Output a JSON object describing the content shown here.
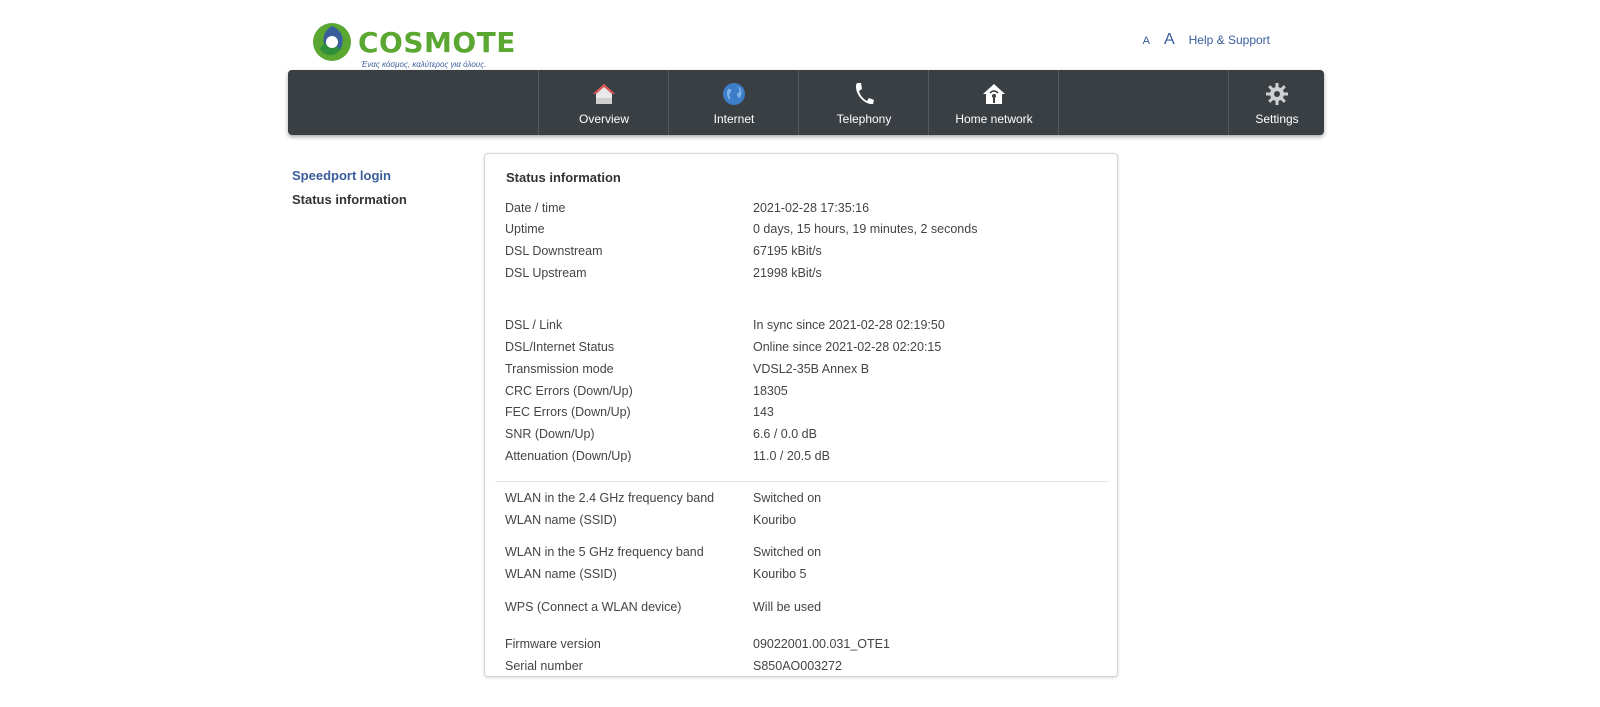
{
  "brand": {
    "name": "COSMOTE",
    "slogan": "Ένας κόσμος, καλύτερος για όλους."
  },
  "topbar": {
    "font_small": "A",
    "font_large": "A",
    "help": "Help & Support"
  },
  "nav": {
    "items": [
      {
        "label": "Overview",
        "icon": "house-icon"
      },
      {
        "label": "Internet",
        "icon": "globe-icon"
      },
      {
        "label": "Telephony",
        "icon": "phone-icon"
      },
      {
        "label": "Home network",
        "icon": "home-network-icon"
      },
      {
        "label": "Settings",
        "icon": "gear-icon"
      }
    ]
  },
  "sidebar": {
    "login": "Speedport login",
    "status": "Status information"
  },
  "panel": {
    "title": "Status information",
    "rows": [
      {
        "key": "Date / time",
        "value": "2021-02-28 17:35:16"
      },
      {
        "key": "Uptime",
        "value": "0 days, 15 hours, 19 minutes, 2 seconds"
      },
      {
        "key": "DSL Downstream",
        "value": "67195 kBit/s"
      },
      {
        "key": "DSL Upstream",
        "value": "21998 kBit/s"
      },
      {
        "key": "DSL / Link",
        "value": "In sync since 2021-02-28 02:19:50"
      },
      {
        "key": "DSL/Internet Status",
        "value": "Online since 2021-02-28 02:20:15"
      },
      {
        "key": "Transmission mode",
        "value": "VDSL2-35B Annex B"
      },
      {
        "key": "CRC Errors (Down/Up)",
        "value": "18305"
      },
      {
        "key": "FEC Errors (Down/Up)",
        "value": "143"
      },
      {
        "key": "SNR (Down/Up)",
        "value": "6.6 / 0.0 dB"
      },
      {
        "key": "Attenuation (Down/Up)",
        "value": "11.0 / 20.5 dB"
      },
      {
        "key": "WLAN in the 2.4 GHz frequency band",
        "value": "Switched on"
      },
      {
        "key": "WLAN name (SSID)",
        "value": "Kouribo"
      },
      {
        "key": "WLAN in the 5 GHz frequency band",
        "value": "Switched on"
      },
      {
        "key": "WLAN name (SSID)",
        "value": "Kouribo 5"
      },
      {
        "key": "WPS (Connect a WLAN device)",
        "value": "Will be used"
      },
      {
        "key": "Firmware version",
        "value": "09022001.00.031_OTE1"
      },
      {
        "key": "Serial number",
        "value": "S850AO003272"
      }
    ]
  },
  "colors": {
    "brand_green": "#5aa832",
    "brand_blue": "#3a5d9c",
    "nav_bg": "#3a3f44"
  }
}
